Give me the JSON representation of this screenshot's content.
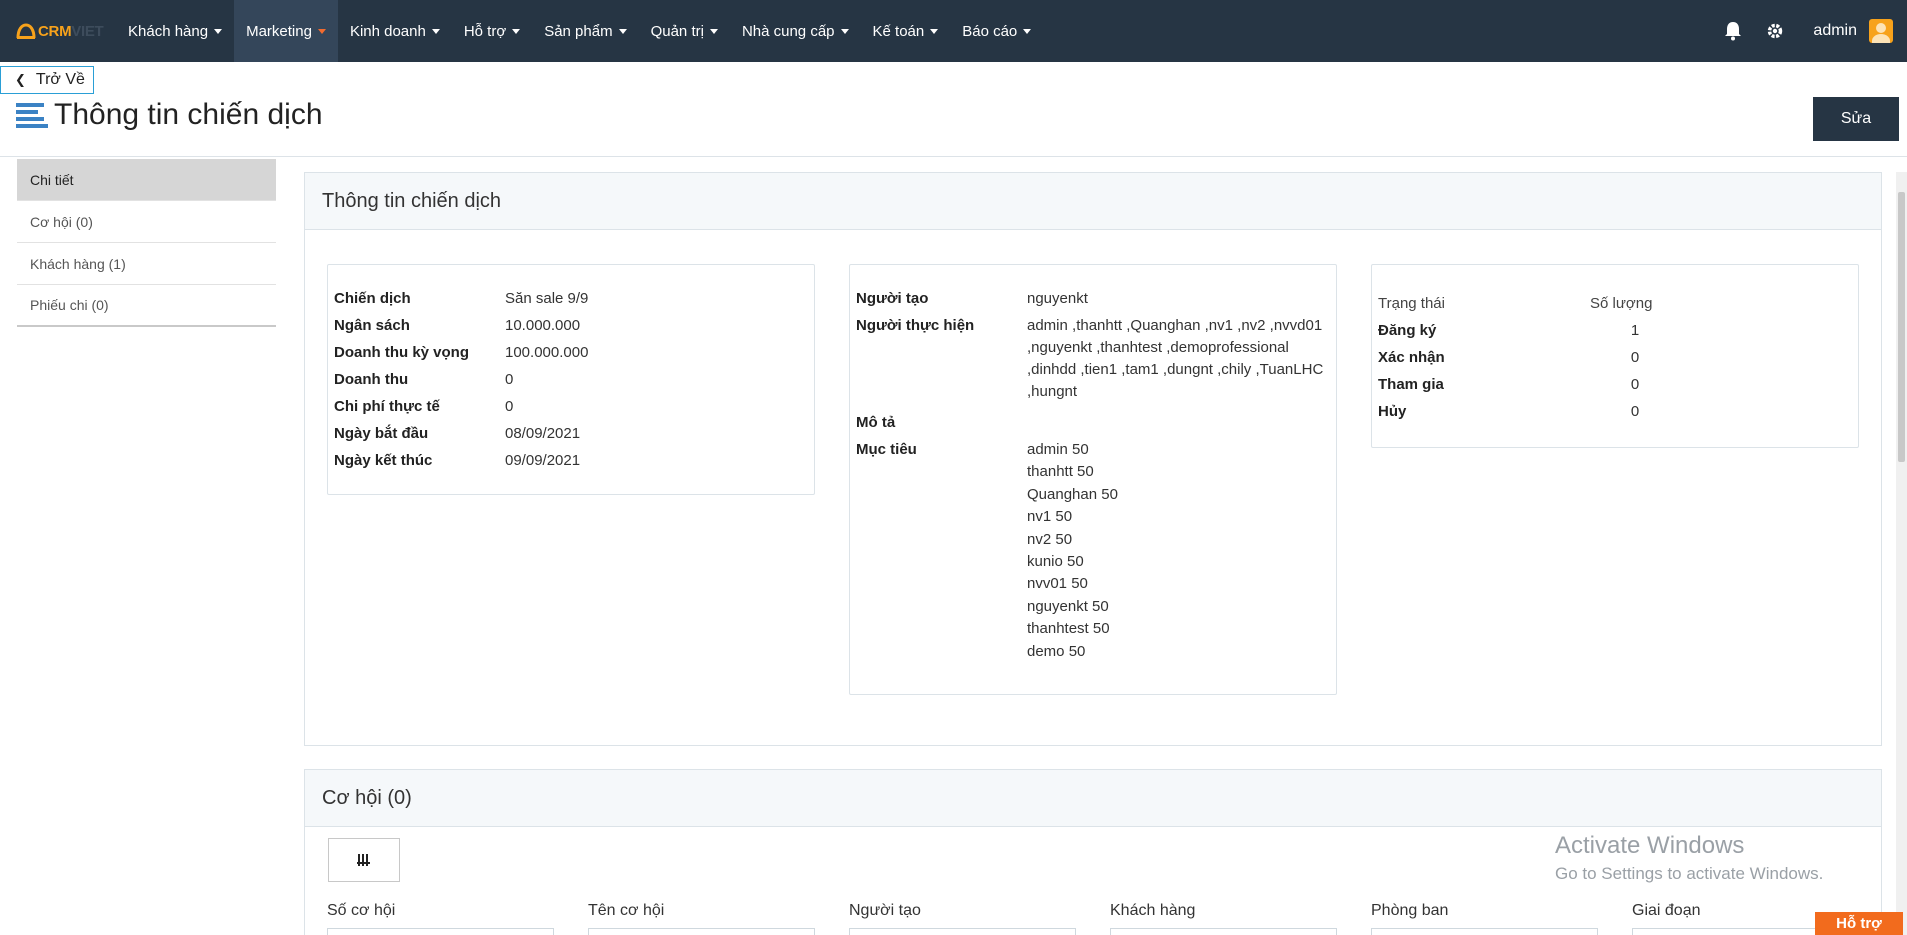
{
  "app": {
    "logo_crm": "CRM",
    "logo_viet": "VIET"
  },
  "nav": {
    "items": [
      {
        "label": "Khách hàng",
        "active": false
      },
      {
        "label": "Marketing",
        "active": true
      },
      {
        "label": "Kinh doanh",
        "active": false
      },
      {
        "label": "Hỗ trợ",
        "active": false
      },
      {
        "label": "Sản phẩm",
        "active": false
      },
      {
        "label": "Quản trị",
        "active": false
      },
      {
        "label": "Nhà cung cấp",
        "active": false
      },
      {
        "label": "Kế toán",
        "active": false
      },
      {
        "label": "Báo cáo",
        "active": false
      }
    ],
    "user": "admin",
    "icons": [
      "bell-icon",
      "gear-icon"
    ],
    "active_color": "#f26b2f",
    "bg_color": "#263544"
  },
  "header": {
    "back_label": "Trở Về",
    "title": "Thông tin chiến dịch",
    "edit_label": "Sửa"
  },
  "sidebar": {
    "items": [
      {
        "label": "Chi tiết",
        "active": true
      },
      {
        "label": "Cơ hội (0)",
        "active": false
      },
      {
        "label": "Khách hàng (1)",
        "active": false
      },
      {
        "label": "Phiếu chi (0)",
        "active": false
      }
    ]
  },
  "info_panel": {
    "title": "Thông tin chiến dịch",
    "card1": [
      {
        "key": "Chiến dịch",
        "value": "Săn sale 9/9"
      },
      {
        "key": "Ngân sách",
        "value": "10.000.000"
      },
      {
        "key": "Doanh thu kỳ vọng",
        "value": "100.000.000"
      },
      {
        "key": "Doanh thu",
        "value": "0"
      },
      {
        "key": "Chi phí thực tế",
        "value": "0"
      },
      {
        "key": "Ngày bắt đầu",
        "value": "08/09/2021"
      },
      {
        "key": "Ngày kết thúc",
        "value": "09/09/2021"
      }
    ],
    "card2": {
      "creator_label": "Người tạo",
      "creator": "nguyenkt",
      "executors_label": "Người thực hiện",
      "executors_lines": [
        "admin ,thanhtt ,Quanghan ,nv1 ,nv2 ,nvvd01",
        ",nguyenkt ,thanhtest ,demoprofessional",
        ",dinhdd ,tien1 ,tam1 ,dungnt ,chily ,TuanLHC",
        ",hungnt"
      ],
      "description_label": "Mô tả",
      "description": "",
      "targets_label": "Mục tiêu",
      "targets": [
        "admin 50",
        "thanhtt 50",
        "Quanghan 50",
        "nv1 50",
        "nv2 50",
        "kunio 50",
        "nvv01 50",
        "nguyenkt 50",
        "thanhtest 50",
        "demo 50"
      ]
    },
    "card3": {
      "header_status": "Trạng thái",
      "header_count": "Số lượng",
      "rows": [
        {
          "key": "Đăng ký",
          "value": "1"
        },
        {
          "key": "Xác nhận",
          "value": "0"
        },
        {
          "key": "Tham gia",
          "value": "0"
        },
        {
          "key": "Hủy",
          "value": "0"
        }
      ]
    }
  },
  "opportunity_panel": {
    "title": "Cơ hội (0)",
    "columns": [
      "Số cơ hội",
      "Tên cơ hội",
      "Người tạo",
      "Khách hàng",
      "Phòng ban",
      "Giai đoạn"
    ]
  },
  "watermark": {
    "line1": "Activate Windows",
    "line2": "Go to Settings to activate Windows."
  },
  "help": {
    "label": "Hỗ trợ",
    "color": "#f26b1d"
  }
}
